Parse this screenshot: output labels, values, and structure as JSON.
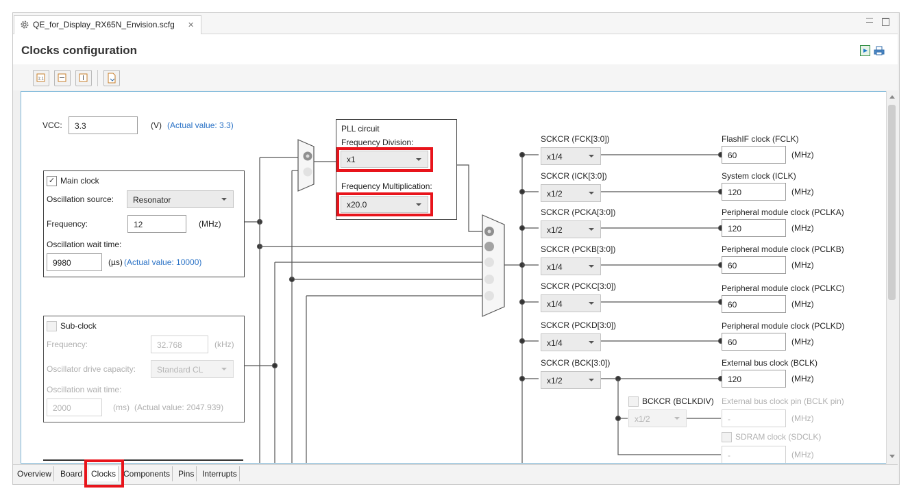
{
  "editor": {
    "file_tab": "QE_for_Display_RX65N_Envision.scfg",
    "page_title": "Clocks configuration"
  },
  "vcc": {
    "label": "VCC:",
    "value": "3.3",
    "unit": "(V)",
    "actual": "(Actual value: 3.3)"
  },
  "main_clock": {
    "checkbox_label": "Main clock",
    "source_label": "Oscillation source:",
    "source_value": "Resonator",
    "frequency_label": "Frequency:",
    "frequency_value": "12",
    "frequency_unit": "(MHz)",
    "wait_label": "Oscillation wait time:",
    "wait_value": "9980",
    "wait_unit": "(µs)",
    "wait_actual": "(Actual value: 10000)"
  },
  "sub_clock": {
    "checkbox_label": "Sub-clock",
    "frequency_label": "Frequency:",
    "frequency_value": "32.768",
    "frequency_unit": "(kHz)",
    "drive_label": "Oscillator drive capacity:",
    "drive_value": "Standard CL",
    "wait_label": "Oscillation wait time:",
    "wait_value": "2000",
    "wait_unit": "(ms)",
    "wait_actual": "(Actual value: 2047.939)"
  },
  "pll": {
    "title": "PLL circuit",
    "div_label": "Frequency Division:",
    "div_value": "x1",
    "mul_label": "Frequency Multiplication:",
    "mul_value": "x20.0"
  },
  "dividers": [
    {
      "label": "SCKCR (FCK[3:0])",
      "value": "x1/4"
    },
    {
      "label": "SCKCR (ICK[3:0])",
      "value": "x1/2"
    },
    {
      "label": "SCKCR (PCKA[3:0])",
      "value": "x1/2"
    },
    {
      "label": "SCKCR (PCKB[3:0])",
      "value": "x1/4"
    },
    {
      "label": "SCKCR (PCKC[3:0])",
      "value": "x1/4"
    },
    {
      "label": "SCKCR (PCKD[3:0])",
      "value": "x1/4"
    },
    {
      "label": "SCKCR (BCK[3:0])",
      "value": "x1/2"
    }
  ],
  "outputs": [
    {
      "label": "FlashIF clock (FCLK)",
      "value": "60",
      "unit": "(MHz)"
    },
    {
      "label": "System clock (ICLK)",
      "value": "120",
      "unit": "(MHz)"
    },
    {
      "label": "Peripheral module clock (PCLKA)",
      "value": "120",
      "unit": "(MHz)"
    },
    {
      "label": "Peripheral module clock (PCLKB)",
      "value": "60",
      "unit": "(MHz)"
    },
    {
      "label": "Peripheral module clock (PCLKC)",
      "value": "60",
      "unit": "(MHz)"
    },
    {
      "label": "Peripheral module clock (PCLKD)",
      "value": "60",
      "unit": "(MHz)"
    },
    {
      "label": "External bus clock (BCLK)",
      "value": "120",
      "unit": "(MHz)"
    }
  ],
  "bclk": {
    "checkbox_label": "BCKCR (BCLKDIV)",
    "div_value": "x1/2",
    "pin_label": "External bus clock pin (BCLK pin)",
    "pin_value": "-",
    "pin_unit": "(MHz)",
    "sdram_label": "SDRAM clock (SDCLK)",
    "sdram_value": "-",
    "sdram_unit": "(MHz)"
  },
  "bottom_tabs": [
    "Overview",
    "Board",
    "Clocks",
    "Components",
    "Pins",
    "Interrupts"
  ],
  "colors": {
    "highlight": "#e8141b",
    "link_blue": "#2a72c6",
    "canvas_border": "#7ab5d8"
  },
  "icons": [
    "gear-icon",
    "close-icon",
    "minimize-icon",
    "maximize-icon",
    "generate-code-icon",
    "print-icon"
  ]
}
